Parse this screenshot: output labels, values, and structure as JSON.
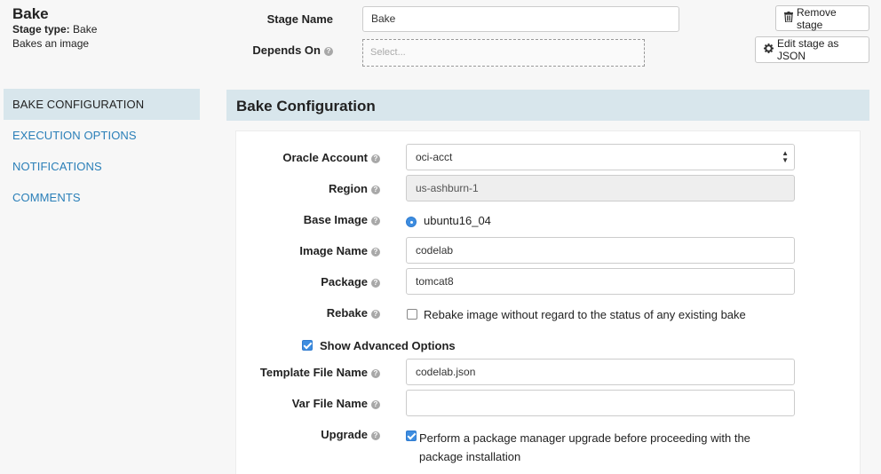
{
  "stage": {
    "title": "Bake",
    "type_label": "Stage type:",
    "type_value": "Bake",
    "description": "Bakes an image"
  },
  "top_form": {
    "stage_name_label": "Stage Name",
    "stage_name_value": "Bake",
    "depends_on_label": "Depends On",
    "depends_on_placeholder": "Select..."
  },
  "buttons": {
    "remove_stage": "Remove stage",
    "edit_json": "Edit stage as JSON"
  },
  "nav": {
    "items": [
      {
        "label": "BAKE CONFIGURATION",
        "active": true
      },
      {
        "label": "EXECUTION OPTIONS",
        "active": false
      },
      {
        "label": "NOTIFICATIONS",
        "active": false
      },
      {
        "label": "COMMENTS",
        "active": false
      }
    ]
  },
  "section": {
    "title": "Bake Configuration"
  },
  "form": {
    "oracle_account": {
      "label": "Oracle Account",
      "value": "oci-acct"
    },
    "region": {
      "label": "Region",
      "value": "us-ashburn-1"
    },
    "base_image": {
      "label": "Base Image",
      "value": "ubuntu16_04"
    },
    "image_name": {
      "label": "Image Name",
      "value": "codelab"
    },
    "package": {
      "label": "Package",
      "value": "tomcat8"
    },
    "rebake": {
      "label": "Rebake",
      "checkbox_label": "Rebake image without regard to the status of any existing bake",
      "checked": false
    },
    "show_advanced": {
      "label": "Show Advanced Options",
      "checked": true
    },
    "template_file_name": {
      "label": "Template File Name",
      "value": "codelab.json"
    },
    "var_file_name": {
      "label": "Var File Name",
      "value": ""
    },
    "upgrade": {
      "label": "Upgrade",
      "checkbox_label_line1": "Perform a package manager upgrade before proceeding with the",
      "checkbox_label_line2": "package installation",
      "checked": true
    }
  },
  "colors": {
    "accent": "#3d8de0",
    "nav_link": "#2a7fb8",
    "section_bg": "#d8e6ec"
  }
}
